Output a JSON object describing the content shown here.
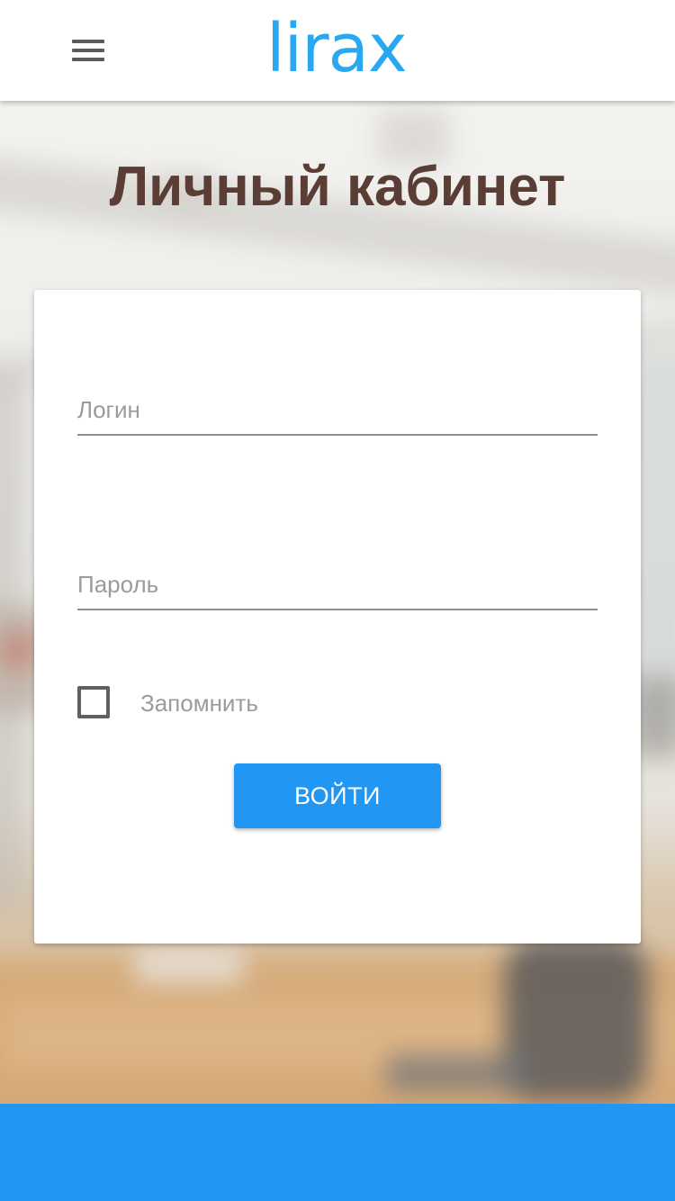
{
  "header": {
    "logo_text": "lirax",
    "menu_icon": "hamburger-menu-icon"
  },
  "main": {
    "title": "Личный кабинет"
  },
  "form": {
    "login_placeholder": "Логин",
    "password_placeholder": "Пароль",
    "remember_label": "Запомнить",
    "remember_checked": false,
    "submit_label": "ВОЙТИ"
  },
  "colors": {
    "accent": "#2196f3",
    "logo": "#2aa8ef",
    "title": "#5a3e35"
  }
}
